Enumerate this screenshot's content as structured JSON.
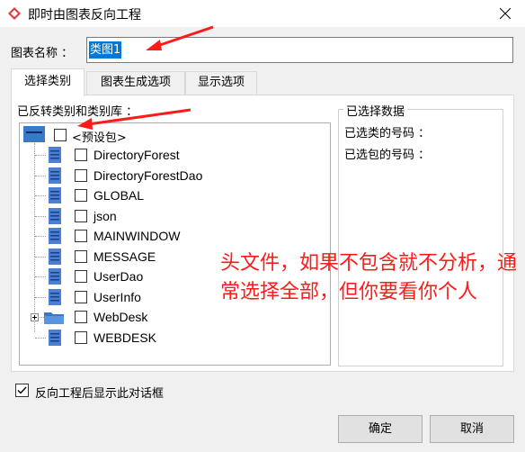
{
  "window": {
    "title": "即时由图表反向工程"
  },
  "name_field": {
    "label": "图表名称 ：",
    "value": "类图1"
  },
  "tabs": [
    {
      "label": "选择类别"
    },
    {
      "label": "图表生成选项"
    },
    {
      "label": "显示选项"
    }
  ],
  "left_group": {
    "label": "已反转类别和类别库 ："
  },
  "tree": {
    "root": {
      "label": "<预设包>"
    },
    "items": [
      {
        "label": "DirectoryForest",
        "icon": "class-file-icon"
      },
      {
        "label": "DirectoryForestDao",
        "icon": "class-file-icon"
      },
      {
        "label": "GLOBAL",
        "icon": "class-file-icon"
      },
      {
        "label": "json",
        "icon": "class-file-icon"
      },
      {
        "label": "MAINWINDOW",
        "icon": "class-file-icon"
      },
      {
        "label": "MESSAGE",
        "icon": "class-file-icon"
      },
      {
        "label": "UserDao",
        "icon": "class-file-icon"
      },
      {
        "label": "UserInfo",
        "icon": "class-file-icon"
      },
      {
        "label": "WebDesk",
        "icon": "folder-icon"
      },
      {
        "label": "WEBDESK",
        "icon": "class-file-icon"
      }
    ]
  },
  "right_group": {
    "title": "已选择数据",
    "class_count_label": "已选类的号码 ：",
    "package_count_label": "已选包的号码 ："
  },
  "annotation": {
    "text": "头文件，如果不包含就不分析，通常选择全部，但你要看你个人",
    "color": "#ff1a1a"
  },
  "show_dialog_checkbox": {
    "label": "反向工程后显示此对话框",
    "checked": true
  },
  "buttons": {
    "ok": "确定",
    "cancel": "取消"
  },
  "colors": {
    "selection": "#0078d7",
    "annotation": "#ff1a1a",
    "class_icon": "#4a7fd4"
  }
}
